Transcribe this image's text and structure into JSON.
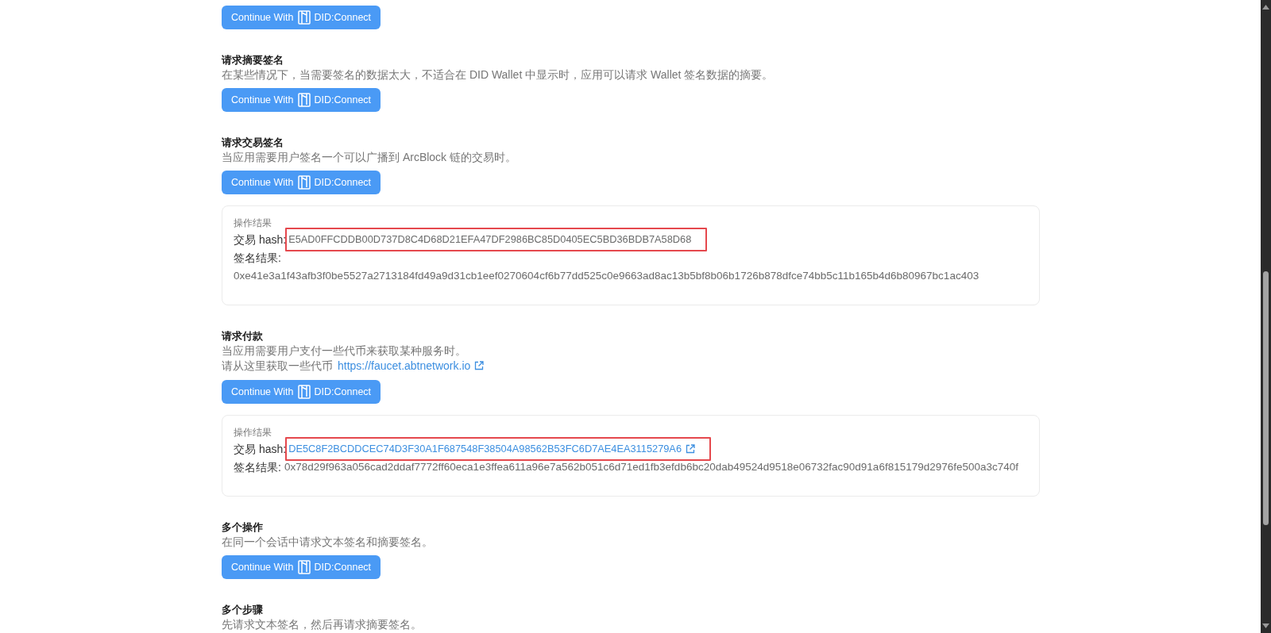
{
  "sections": [
    {
      "button": {
        "label": "Continue With",
        "brand": "DID:Connect"
      }
    },
    {
      "heading": "请求摘要签名",
      "description": "在某些情况下，当需要签名的数据太大，不适合在 DID Wallet 中显示时，应用可以请求 Wallet 签名数据的摘要。",
      "button": {
        "label": "Continue With",
        "brand": "DID:Connect"
      }
    },
    {
      "heading": "请求交易签名",
      "description": "当应用需要用户签名一个可以广播到 ArcBlock 链的交易时。",
      "button": {
        "label": "Continue With",
        "brand": "DID:Connect"
      },
      "result": {
        "title": "操作结果",
        "hash": {
          "label": "交易 hash:",
          "value": "E5AD0FFCDDB00D737D8C4D68D21EFA47DF2986BC85D0405EC5BD36BDB7A58D68",
          "linked": false,
          "highlighted": true
        },
        "signature": {
          "label": "签名结果:",
          "value": "0xe41e3a1f43afb3f0be5527a2713184fd49a9d31cb1eef0270604cf6b77dd525c0e9663ad8ac13b5bf8b06b1726b878dfce74bb5c11b165b4d6b80967bc1ac403",
          "wrapped": true
        }
      }
    },
    {
      "heading": "请求付款",
      "description": "当应用需要用户支付一些代币来获取某种服务时。",
      "note": {
        "text": "请从这里获取一些代币",
        "link": "https://faucet.abtnetwork.io"
      },
      "button": {
        "label": "Continue With",
        "brand": "DID:Connect"
      },
      "result": {
        "title": "操作结果",
        "hash": {
          "label": "交易 hash:",
          "value": "DE5C8F2BCDDCEC74D3F30A1F687548F38504A98562B53FC6D7AE4EA3115279A6",
          "linked": true,
          "highlighted": true
        },
        "signature": {
          "label": "签名结果:",
          "value": "0x78d29f963a056cad2ddaf7772ff60eca1e3ffea611a96e7a562b051c6d71ed1fb3efdb6bc20dab49524d9518e06732fac90d91a6f815179d2976fe500a3c740f",
          "wrapped": false
        }
      }
    },
    {
      "heading": "多个操作",
      "description": "在同一个会话中请求文本签名和摘要签名。",
      "button": {
        "label": "Continue With",
        "brand": "DID:Connect"
      }
    },
    {
      "heading": "多个步骤",
      "description": "先请求文本签名，然后再请求摘要签名。"
    }
  ]
}
